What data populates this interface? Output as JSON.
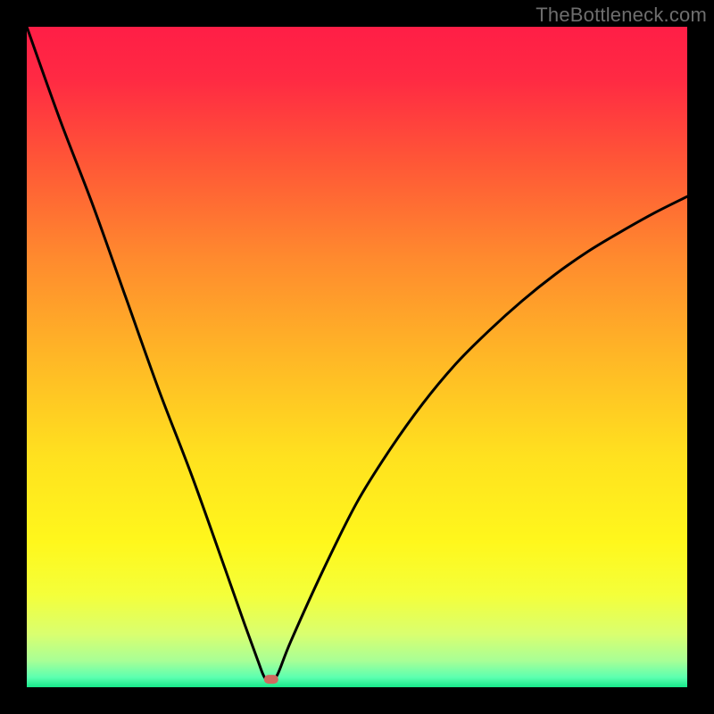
{
  "watermark": "TheBottleneck.com",
  "chart_data": {
    "type": "line",
    "title": "",
    "xlabel": "",
    "ylabel": "",
    "xlim": [
      0,
      100
    ],
    "ylim": [
      0,
      100
    ],
    "series": [
      {
        "name": "curve",
        "x": [
          0,
          5,
          10,
          15,
          20,
          25,
          30,
          33,
          35,
          36,
          37,
          38,
          40,
          45,
          50,
          55,
          60,
          65,
          70,
          75,
          80,
          85,
          90,
          95,
          100
        ],
        "y": [
          100,
          86,
          73,
          59,
          45,
          32,
          18,
          9.5,
          4,
          1.5,
          1,
          2,
          7,
          18,
          28,
          36,
          43,
          49,
          54,
          58.5,
          62.5,
          66,
          69,
          71.8,
          74.3
        ]
      }
    ],
    "marker": {
      "x": 37,
      "y": 1.2,
      "color": "#d06a5f"
    },
    "gradient_stops": [
      {
        "offset": 0.0,
        "color": "#ff1e46"
      },
      {
        "offset": 0.08,
        "color": "#ff2a43"
      },
      {
        "offset": 0.2,
        "color": "#ff5537"
      },
      {
        "offset": 0.35,
        "color": "#ff8a2e"
      },
      {
        "offset": 0.5,
        "color": "#ffb726"
      },
      {
        "offset": 0.65,
        "color": "#ffe11f"
      },
      {
        "offset": 0.78,
        "color": "#fff71c"
      },
      {
        "offset": 0.86,
        "color": "#f4ff3a"
      },
      {
        "offset": 0.92,
        "color": "#d9ff70"
      },
      {
        "offset": 0.96,
        "color": "#a8ff96"
      },
      {
        "offset": 0.985,
        "color": "#5cffb0"
      },
      {
        "offset": 1.0,
        "color": "#17e88a"
      }
    ]
  }
}
